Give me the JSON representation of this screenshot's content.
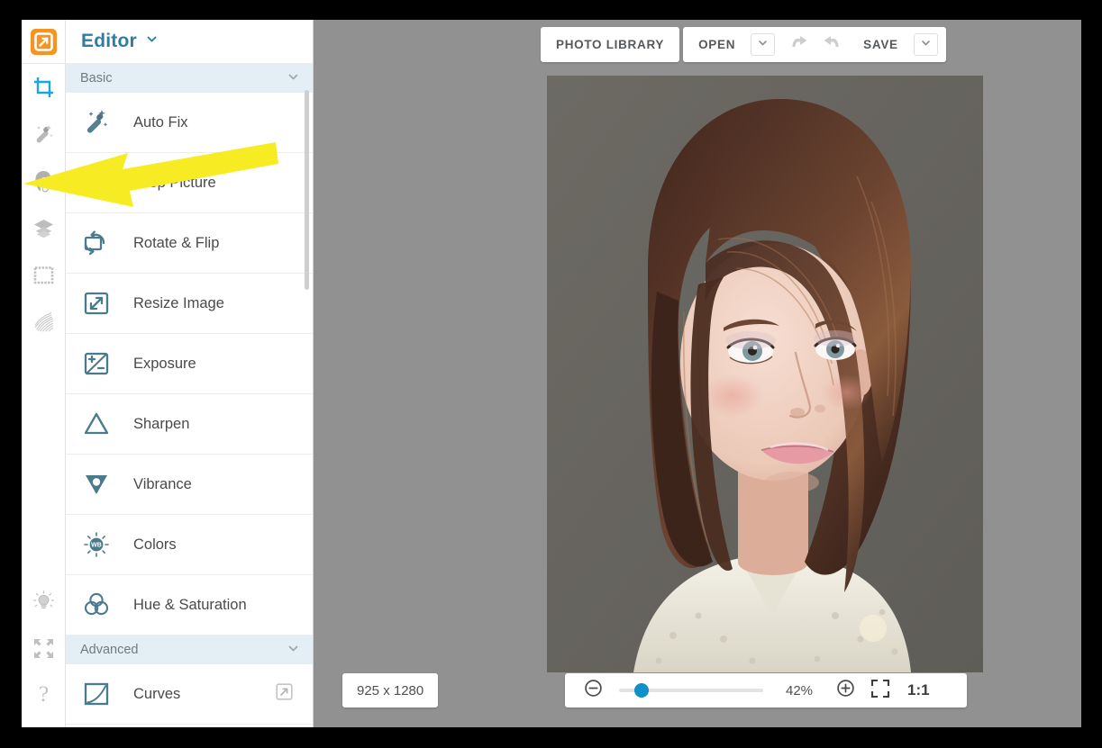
{
  "app": {
    "logo_icon": "orange-arrow-logo-icon",
    "background_color": "#919191",
    "accent_color": "#2b7ea1"
  },
  "rail": {
    "items": [
      {
        "name": "crop-tool",
        "icon": "crop-icon",
        "active": true
      },
      {
        "name": "touchup-tool",
        "icon": "magic-wand-icon",
        "active": false
      },
      {
        "name": "portrait-tool",
        "icon": "face-portrait-icon",
        "active": false
      },
      {
        "name": "layers-tool",
        "icon": "layers-icon",
        "active": false
      },
      {
        "name": "frames-tool",
        "icon": "frame-icon",
        "active": false
      },
      {
        "name": "textures-tool",
        "icon": "texture-icon",
        "active": false
      }
    ],
    "bottom_items": [
      {
        "name": "tips",
        "icon": "lightbulb-icon"
      },
      {
        "name": "fullscreen",
        "icon": "expand-arrows-icon"
      },
      {
        "name": "help",
        "icon": "question-mark-icon",
        "label": "?"
      }
    ]
  },
  "panel": {
    "title": "Editor",
    "title_caret_icon": "chevron-down-icon",
    "groups": [
      {
        "label": "Basic",
        "caret_icon": "chevron-down-icon",
        "items": [
          {
            "label": "Auto Fix",
            "icon": "magic-wand-icon"
          },
          {
            "label": "Crop Picture",
            "icon": "crop-picture-icon"
          },
          {
            "label": "Rotate & Flip",
            "icon": "rotate-flip-icon"
          },
          {
            "label": "Resize Image",
            "icon": "resize-image-icon"
          },
          {
            "label": "Exposure",
            "icon": "exposure-icon"
          },
          {
            "label": "Sharpen",
            "icon": "sharpen-triangle-icon"
          },
          {
            "label": "Vibrance",
            "icon": "vibrance-icon"
          },
          {
            "label": "Colors",
            "icon": "white-balance-icon",
            "icon_text": "WB"
          },
          {
            "label": "Hue & Saturation",
            "icon": "hue-saturation-icon"
          }
        ]
      },
      {
        "label": "Advanced",
        "caret_icon": "chevron-down-icon",
        "items": [
          {
            "label": "Curves",
            "icon": "curves-icon",
            "badge_icon": "external-link-icon"
          }
        ]
      }
    ]
  },
  "toolbar": {
    "photo_library_label": "PHOTO LIBRARY",
    "open_label": "OPEN",
    "open_caret_icon": "chevron-down-icon",
    "undo_icon": "undo-arrow-icon",
    "redo_icon": "redo-arrow-icon",
    "save_label": "SAVE",
    "save_caret_icon": "chevron-down-icon"
  },
  "statusbar": {
    "dimensions": "925 x 1280",
    "zoom_out_icon": "zoom-out-icon",
    "zoom_in_icon": "zoom-in-icon",
    "zoom_percent": "42%",
    "zoom_slider_value": 12,
    "fit_screen_icon": "fit-to-screen-icon",
    "actual_size_label": "1:1"
  },
  "canvas": {
    "photo_alt": "portrait-photo-woman-bob-haircut",
    "photo_background_color": "#6f6c67"
  },
  "annotation": {
    "arrow_icon": "yellow-pointer-arrow-icon",
    "arrow_color": "#f7ec24",
    "points_to": "portrait-tool"
  }
}
